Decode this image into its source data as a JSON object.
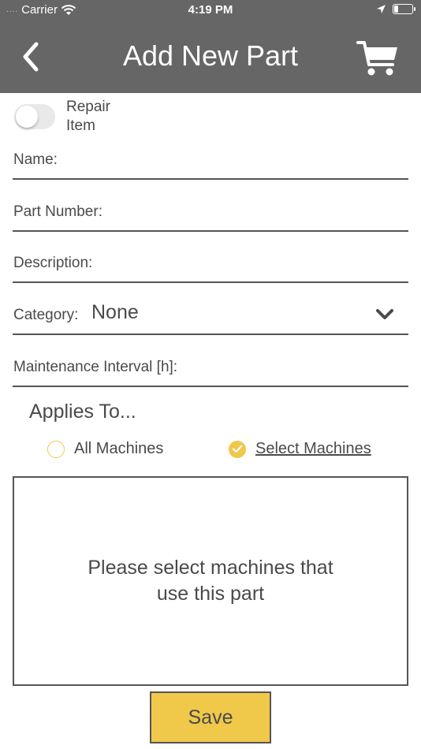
{
  "status_bar": {
    "dots": "....",
    "carrier": "Carrier",
    "time": "4:19 PM",
    "battery_level": 0.25
  },
  "nav": {
    "title": "Add New Part",
    "back_icon": "chevron-left-icon",
    "cart_icon": "cart-icon"
  },
  "repair_toggle": {
    "label": "Repair Item",
    "on": false
  },
  "form": {
    "name_label": "Name:",
    "name_value": "",
    "part_number_label": "Part Number:",
    "part_number_value": "",
    "description_label": "Description:",
    "description_value": "",
    "category_label": "Category:",
    "category_value": "None",
    "maintenance_label": "Maintenance Interval [h]:",
    "maintenance_value": ""
  },
  "applies_to": {
    "title": "Applies To...",
    "options": [
      {
        "label": "All Machines",
        "selected": false
      },
      {
        "label": "Select Machines",
        "selected": true
      }
    ]
  },
  "machines_box": {
    "message": "Please select machines that use this part"
  },
  "save_button": {
    "label": "Save"
  },
  "colors": {
    "header": "#666666",
    "accent": "#f0c84a",
    "text": "#4a4a4a",
    "border": "#555555"
  }
}
